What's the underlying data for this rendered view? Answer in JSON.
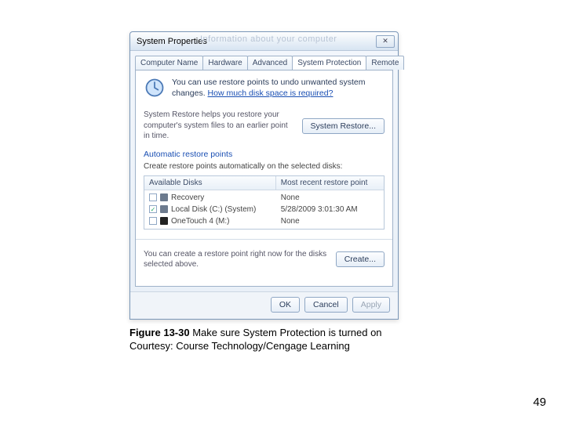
{
  "window": {
    "title": "System Properties",
    "ghost": "Information about your computer",
    "close": "✕"
  },
  "tabs": [
    "Computer Name",
    "Hardware",
    "Advanced",
    "System Protection",
    "Remote"
  ],
  "info": {
    "text": "You can use restore points to undo unwanted system changes. ",
    "link": "How much disk space is required?"
  },
  "restore": {
    "text": "System Restore helps you restore your computer's system files to an earlier point in time.",
    "button": "System Restore..."
  },
  "auto": {
    "heading": "Automatic restore points",
    "sub": "Create restore points automatically on the selected disks:",
    "col1": "Available Disks",
    "col2": "Most recent restore point",
    "rows": [
      {
        "checked": false,
        "icon": "hdd",
        "name": "Recovery",
        "recent": "None"
      },
      {
        "checked": true,
        "icon": "hdd",
        "name": "Local Disk (C:) (System)",
        "recent": "5/28/2009 3:01:30 AM"
      },
      {
        "checked": false,
        "icon": "usb",
        "name": "OneTouch 4 (M:)",
        "recent": "None"
      }
    ]
  },
  "create": {
    "text": "You can create a restore point right now for the disks selected above.",
    "button": "Create..."
  },
  "buttons": {
    "ok": "OK",
    "cancel": "Cancel",
    "apply": "Apply"
  },
  "caption_bold": "Figure 13-30",
  "caption_rest": " Make sure System Protection is turned on",
  "caption_line2": "Courtesy: Course Technology/Cengage Learning",
  "pagenum": "49"
}
